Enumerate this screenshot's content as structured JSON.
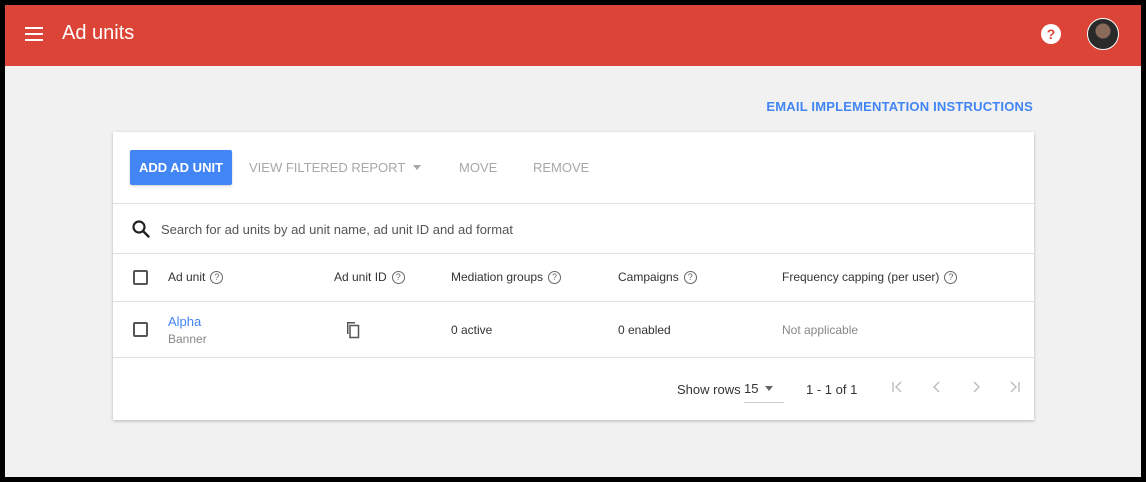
{
  "appbar": {
    "title": "Ad units",
    "menu_icon": "menu-icon",
    "help_icon_label": "?",
    "accent_color": "#db4437"
  },
  "links": {
    "email_instructions": "EMAIL IMPLEMENTATION INSTRUCTIONS"
  },
  "toolbar": {
    "add_label": "ADD AD UNIT",
    "view_report_label": "VIEW FILTERED REPORT",
    "move_label": "MOVE",
    "remove_label": "REMOVE",
    "primary_color": "#4285f4"
  },
  "search": {
    "placeholder": "Search for ad units by ad unit name, ad unit ID and ad format",
    "value": ""
  },
  "table": {
    "columns": [
      {
        "label": "Ad unit"
      },
      {
        "label": "Ad unit ID"
      },
      {
        "label": "Mediation groups"
      },
      {
        "label": "Campaigns"
      },
      {
        "label": "Frequency capping (per user)"
      }
    ],
    "help_glyph": "?",
    "rows": [
      {
        "name": "Alpha",
        "format": "Banner",
        "mediation": "0 active",
        "campaigns": "0 enabled",
        "frequency": "Not applicable"
      }
    ]
  },
  "footer": {
    "show_rows_label": "Show rows",
    "rows_value": "15",
    "range_text": "1 - 1 of 1"
  }
}
